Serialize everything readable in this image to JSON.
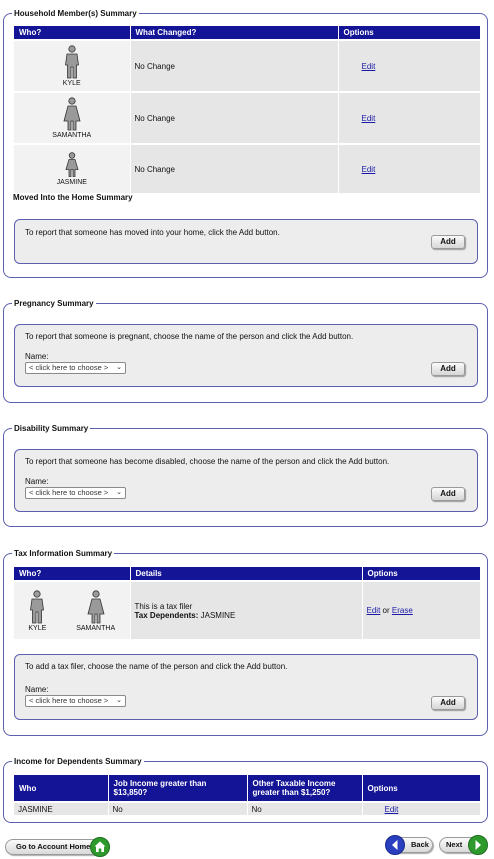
{
  "household": {
    "legend": "Household Member(s) Summary",
    "headers": [
      "Who?",
      "What Changed?",
      "Options"
    ],
    "rows": [
      {
        "name": "KYLE",
        "change": "No Change",
        "option": "Edit",
        "gender": "male"
      },
      {
        "name": "SAMANTHA",
        "change": "No Change",
        "option": "Edit",
        "gender": "female"
      },
      {
        "name": "JASMINE",
        "change": "No Change",
        "option": "Edit",
        "gender": "child"
      }
    ]
  },
  "moved_in": {
    "title": "Moved Into the Home Summary",
    "message": "To report that someone has moved into your home, click the Add button.",
    "add_label": "Add"
  },
  "pregnancy": {
    "legend": "Pregnancy Summary",
    "message": "To report that someone is pregnant, choose the name of the person and click the Add button.",
    "name_label": "Name:",
    "select_value": "< click here to choose >",
    "add_label": "Add"
  },
  "disability": {
    "legend": "Disability Summary",
    "message": "To report that someone has become disabled, choose the name of the person and click the Add button.",
    "name_label": "Name:",
    "select_value": "< click here to choose >",
    "add_label": "Add"
  },
  "tax": {
    "legend": "Tax Information Summary",
    "headers": [
      "Who?",
      "Details",
      "Options"
    ],
    "people": [
      "KYLE",
      "SAMANTHA"
    ],
    "detail_line1": "This is a tax filer",
    "dependents_label": "Tax Dependents:",
    "dependents_value": "JASMINE",
    "edit_label": "Edit",
    "or_text": "or",
    "erase_label": "Erase",
    "message": "To add a tax filer, choose the name of the person and click the Add button.",
    "name_label": "Name:",
    "select_value": "< click here to choose >",
    "add_label": "Add"
  },
  "income": {
    "legend": "Income for Dependents Summary",
    "headers": [
      "Who",
      "Job Income greater than $13,850?",
      "Other Taxable Income greater than $1,250?",
      "Options"
    ],
    "row": {
      "who": "JASMINE",
      "job": "No",
      "other": "No",
      "option": "Edit"
    }
  },
  "nav": {
    "account_home": "Go to Account Home",
    "back": "Back",
    "next": "Next"
  },
  "colors": {
    "header_blue": "#141496",
    "border_blue": "#5b5fb0",
    "link_blue": "#1a1aa6",
    "nav_green": "#2e9a2e",
    "nav_blue": "#2a3fbf"
  }
}
